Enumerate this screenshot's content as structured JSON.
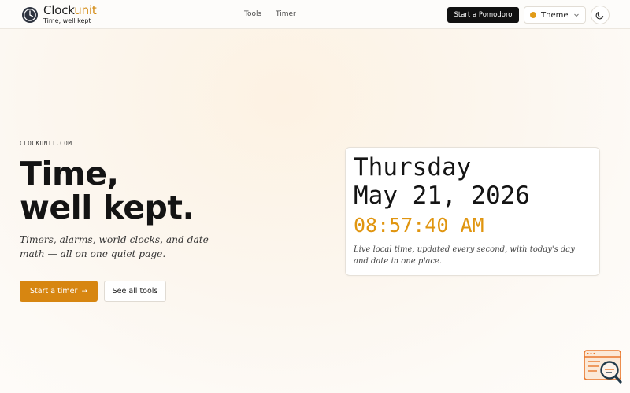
{
  "header": {
    "brand_prefix": "Clock",
    "brand_accent": "unit",
    "tagline": "Time, well kept",
    "nav": [
      {
        "label": "Tools"
      },
      {
        "label": "Timer"
      }
    ],
    "cta_label": "Start a Pomodoro",
    "theme_label": "Theme",
    "icons": {
      "logo": "clock-icon",
      "theme_dot": "color-dot-icon",
      "chevron": "chevron-down-icon",
      "mode": "moon-icon"
    }
  },
  "hero": {
    "eyebrow": "CLOCKUNIT.COM",
    "title_line1": "Time,",
    "title_line2": "well kept.",
    "subtitle": "Timers, alarms, world clocks, and date math — all on one quiet page.",
    "primary_button": "Start a timer",
    "primary_arrow": "→",
    "secondary_button": "See all tools"
  },
  "clock": {
    "day": "Thursday",
    "date": "May 21, 2026",
    "time": "08:57:40 AM",
    "note": "Live local time, updated every second, with today's day and date in one place."
  },
  "corner_widget": {
    "icon": "search-report-icon"
  },
  "colors": {
    "accent": "#d78611",
    "time_accent": "#e0950f",
    "dark_button": "#111111",
    "text": "#141414"
  }
}
